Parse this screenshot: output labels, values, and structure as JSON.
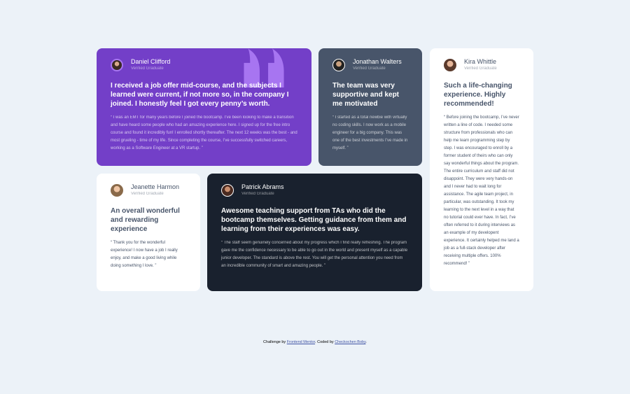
{
  "testimonials": [
    {
      "name": "Daniel Clifford",
      "role": "Verified Graduate",
      "headline": "I received a job offer mid-course, and the subjects I learned were current, if not more so, in the company I joined. I honestly feel I got every penny’s worth.",
      "body": "“ I was an EMT for many years before I joined the bootcamp. I’ve been looking to make a transition and have heard some people who had an amazing experience here. I signed up for the free intro course and found it incredibly fun! I enrolled shortly thereafter. The next 12 weeks was the best - and most grueling - time of my life. Since completing the course, I’ve successfully switched careers, working as a Software Engineer at a VR startup. ”"
    },
    {
      "name": "Jonathan Walters",
      "role": "Verified Graduate",
      "headline": "The team was very supportive and kept me motivated",
      "body": "“ I started as a total newbie with virtually no coding skills. I now work as a mobile engineer for a big company. This was one of the best investments I’ve made in myself. ”"
    },
    {
      "name": "Kira Whittle",
      "role": "Verified Graduate",
      "headline": "Such a life-changing experience. Highly recommended!",
      "body": "“ Before joining the bootcamp, I’ve never written a line of code. I needed some structure from professionals who can help me learn programming step by step. I was encouraged to enroll by a former student of theirs who can only say wonderful things about the program. The entire curriculum and staff did not disappoint. They were very hands-on and I never had to wait long for assistance. The agile team project, in particular, was outstanding. It took my learning to the next level in a way that no tutorial could ever have. In fact, I’ve often referred to it during interviews as an example of my developent experience. It certainly helped me land a job as a full-stack developer after receiving multiple offers. 100% recommend! ”"
    },
    {
      "name": "Jeanette Harmon",
      "role": "Verified Graduate",
      "headline": "An overall wonderful and rewarding experience",
      "body": "“ Thank you for the wonderful experience! I now have a job I really enjoy, and make a good living while doing something I love. ”"
    },
    {
      "name": "Patrick Abrams",
      "role": "Verified Graduate",
      "headline": "Awesome teaching support from TAs who did the bootcamp themselves. Getting guidance from them and learning from their experiences was easy.",
      "body": "“ The staff seem genuinely concerned about my progress which I find really refreshing. The program gave me the confidence necessary to be able to go out in the world and present myself as a capable junior developer. The standard is above the rest. You will get the personal attention you need from an incredible community of smart and amazing people. ”"
    }
  ],
  "attribution": {
    "prefix": "Challenge by",
    "link1": "Frontend Mentor",
    "middle": ". Coded by",
    "link2": "Checkochen Boby",
    "suffix": "."
  },
  "colors": {
    "background": "#ecf2f8",
    "violet": "#733fc8",
    "grayish_blue": "#48556a",
    "dark_blackish_blue": "#19212e",
    "white": "#ffffff"
  }
}
